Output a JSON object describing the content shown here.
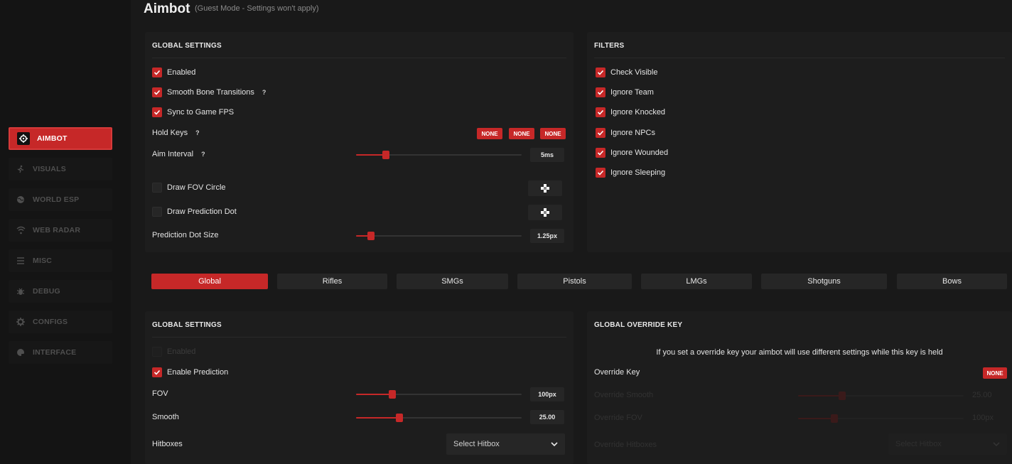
{
  "header": {
    "title": "Aimbot",
    "subtitle": "(Guest Mode - Settings won't apply)"
  },
  "colors": {
    "accent": "#c62828",
    "background": "#191919",
    "panel": "#1d1d1d"
  },
  "sidebar": {
    "items": [
      {
        "label": "AIMBOT",
        "icon": "crosshair-icon",
        "active": true
      },
      {
        "label": "VISUALS",
        "icon": "running-figure-icon",
        "active": false
      },
      {
        "label": "WORLD ESP",
        "icon": "globe-icon",
        "active": false
      },
      {
        "label": "WEB RADAR",
        "icon": "wifi-icon",
        "active": false
      },
      {
        "label": "MISC",
        "icon": "menu-icon",
        "active": false
      },
      {
        "label": "DEBUG",
        "icon": "bug-icon",
        "active": false
      },
      {
        "label": "CONFIGS",
        "icon": "gear-icon",
        "active": false
      },
      {
        "label": "INTERFACE",
        "icon": "palette-icon",
        "active": false
      }
    ]
  },
  "global_settings": {
    "title": "GLOBAL SETTINGS",
    "enabled": {
      "label": "Enabled",
      "checked": true
    },
    "smooth_bone": {
      "label": "Smooth Bone Transitions",
      "checked": true,
      "help": "?"
    },
    "sync_fps": {
      "label": "Sync to Game FPS",
      "checked": true
    },
    "hold_keys": {
      "label": "Hold Keys",
      "help": "?",
      "keys": [
        "NONE",
        "NONE",
        "NONE"
      ]
    },
    "aim_interval": {
      "label": "Aim Interval",
      "help": "?",
      "value": "5ms",
      "level": 0.18
    },
    "draw_fov": {
      "label": "Draw FOV Circle",
      "checked": false
    },
    "draw_pred": {
      "label": "Draw Prediction Dot",
      "checked": false
    },
    "pred_size": {
      "label": "Prediction Dot Size",
      "value": "1.25px",
      "level": 0.09
    }
  },
  "filters": {
    "title": "FILTERS",
    "items": [
      {
        "label": "Check Visible",
        "checked": true
      },
      {
        "label": "Ignore Team",
        "checked": true
      },
      {
        "label": "Ignore Knocked",
        "checked": true
      },
      {
        "label": "Ignore NPCs",
        "checked": true
      },
      {
        "label": "Ignore Wounded",
        "checked": true
      },
      {
        "label": "Ignore Sleeping",
        "checked": true
      }
    ]
  },
  "weapon_tabs": [
    "Global",
    "Rifles",
    "SMGs",
    "Pistols",
    "LMGs",
    "Shotguns",
    "Bows"
  ],
  "weapon_settings": {
    "title": "GLOBAL SETTINGS",
    "enabled": {
      "label": "Enabled"
    },
    "enable_prediction": {
      "label": "Enable Prediction",
      "checked": true
    },
    "fov": {
      "label": "FOV",
      "value": "100px",
      "level": 0.22
    },
    "smooth": {
      "label": "Smooth",
      "value": "25.00",
      "level": 0.26
    },
    "hitboxes": {
      "label": "Hitboxes",
      "placeholder": "Select Hitbox"
    }
  },
  "override": {
    "title": "GLOBAL OVERRIDE KEY",
    "info": "If you set a override key your aimbot will use different settings while this key is held",
    "key_label": "Override Key",
    "key_value": "NONE",
    "smooth_label": "Override Smooth",
    "smooth_value": "25.00",
    "fov_label": "Override FOV",
    "fov_value": "100px",
    "hitboxes_label": "Override Hitboxes",
    "hitboxes_placeholder": "Select Hitbox"
  }
}
